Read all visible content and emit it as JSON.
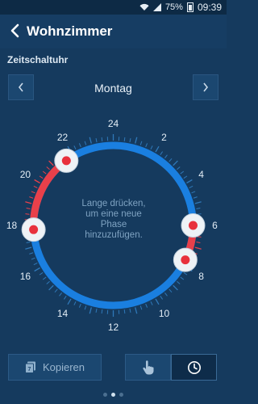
{
  "status_bar": {
    "battery": "75%",
    "time": "09:39"
  },
  "header": {
    "title": "Wohnzimmer"
  },
  "section_label": "Zeitschaltuhr",
  "day_selector": {
    "day": "Montag"
  },
  "dial": {
    "hour_labels": [
      "24",
      "2",
      "4",
      "6",
      "8",
      "10",
      "12",
      "14",
      "16",
      "18",
      "20",
      "22"
    ],
    "hint": "Lange drücken, um eine neue Phase hinzuzufügen.",
    "phases": [
      {
        "start_hour": 17.8,
        "end_hour": 21.6,
        "color": "#e8404a"
      },
      {
        "start_hour": 6.0,
        "end_hour": 7.7,
        "color": "#e8404a"
      }
    ],
    "ring_color": "#1a7fe0",
    "handle_hours": [
      21.6,
      17.8,
      6.0,
      7.7
    ]
  },
  "buttons": {
    "copy_label": "Kopieren"
  },
  "page_dots": {
    "count": 3,
    "active": 1
  }
}
